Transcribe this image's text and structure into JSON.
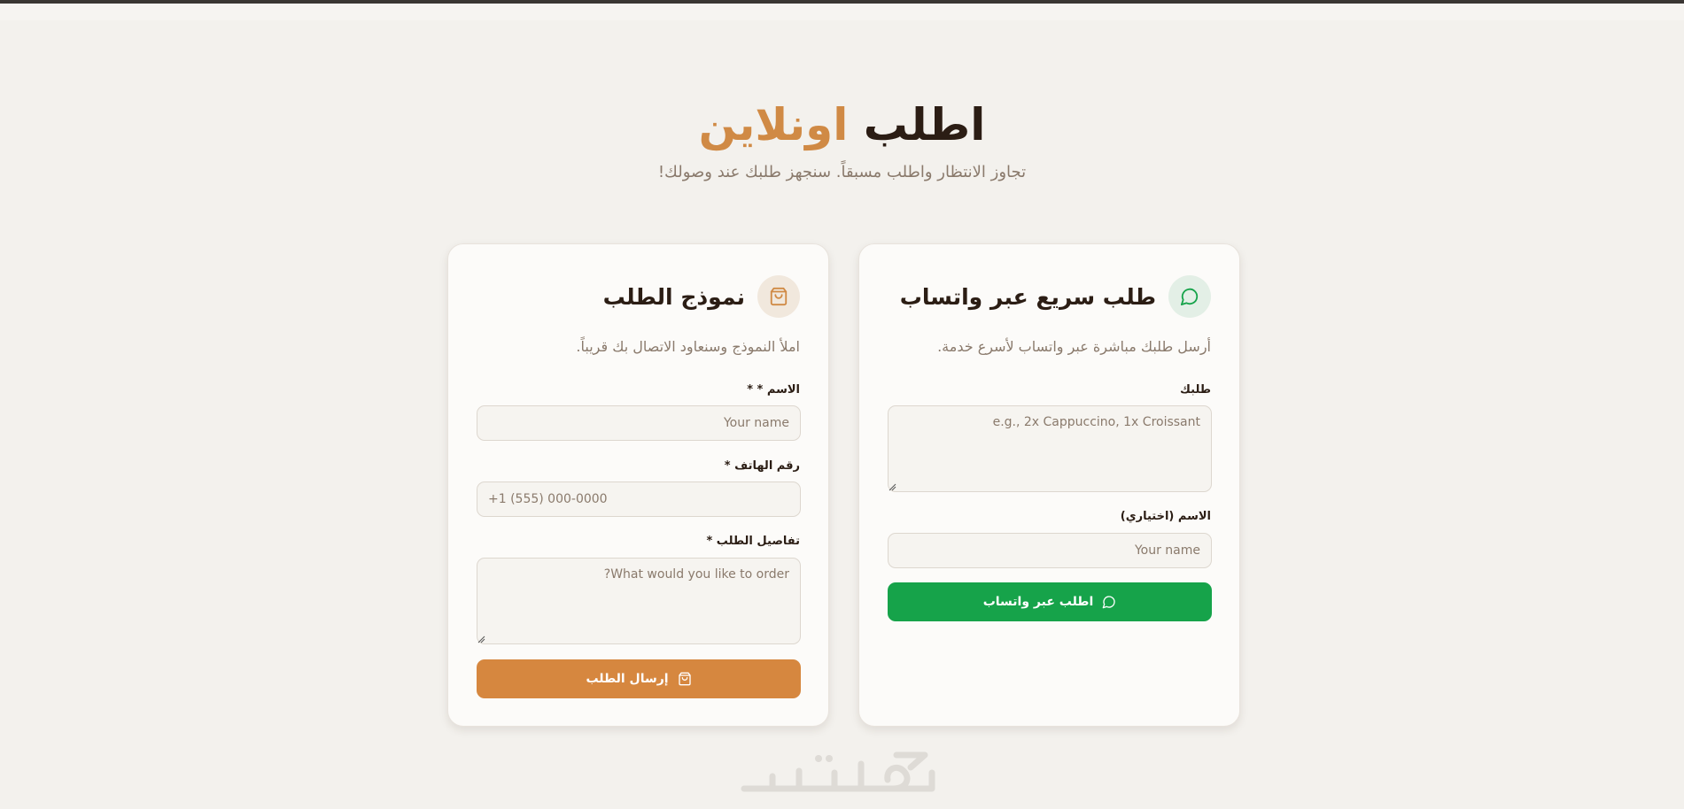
{
  "hero": {
    "title_dark": "اطلب",
    "title_accent": "اونلاين",
    "subtitle": "تجاوز الانتظار واطلب مسبقاً. سنجهز طلبك عند وصولك!"
  },
  "whatsapp_card": {
    "icon": "chat-bubble-icon",
    "title": "طلب سريع عبر واتساب",
    "description": "أرسل طلبك مباشرة عبر واتساب لأسرع خدمة.",
    "order_label": "طلبك",
    "order_placeholder": "e.g., 2x Cappuccino, 1x Croissant",
    "name_label": "الاسم (اختياري)",
    "name_placeholder": "Your name",
    "button_label": "اطلب عبر واتساب"
  },
  "form_card": {
    "icon": "shopping-bag-icon",
    "title": "نموذج الطلب",
    "description": "املأ النموذج وسنعاود الاتصال بك قريباً.",
    "name_label": "الاسم * *",
    "name_placeholder": "Your name",
    "phone_label": "رقم الهاتف *",
    "phone_placeholder": "+1 (555) 000-0000",
    "details_label": "تفاصيل الطلب *",
    "details_placeholder": "What would you like to order?",
    "button_label": "إرسال الطلب"
  },
  "footer": {
    "watermark": "خمسات"
  },
  "colors": {
    "accent": "#d08a45",
    "whatsapp_green": "#16a34a",
    "submit_orange": "#d6873f",
    "background": "#f3f1ed",
    "text_dark": "#2b1d14",
    "text_muted": "#8a7a6c"
  }
}
